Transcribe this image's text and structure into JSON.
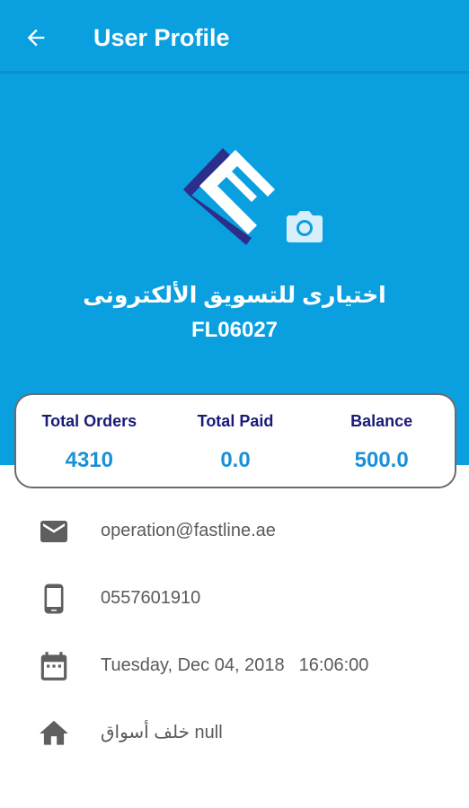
{
  "appbar": {
    "title": "User Profile",
    "back_icon": "arrow-back-icon",
    "color": "#0aa0e0"
  },
  "profile": {
    "logo_icon": "company-logo-f-icon",
    "camera_icon": "camera-icon",
    "company_name": "اختيارى للتسويق الألكترونى",
    "account_id": "FL06027"
  },
  "stats": [
    {
      "label": "Total Orders",
      "value": "4310"
    },
    {
      "label": "Total Paid",
      "value": "0.0"
    },
    {
      "label": "Balance",
      "value": "500.0"
    }
  ],
  "info": {
    "email": {
      "icon": "email-icon",
      "text": "operation@fastline.ae"
    },
    "phone": {
      "icon": "phone-icon",
      "text": "0557601910"
    },
    "date": {
      "icon": "calendar-icon",
      "date_text": "Tuesday, Dec 04, 2018",
      "time_text": "16:06:00"
    },
    "address": {
      "icon": "home-icon",
      "text": "خلف أسواق null"
    }
  },
  "colors": {
    "primary": "#0aa0e0",
    "stat_label": "#1a1a7a",
    "stat_value": "#1a90d8",
    "logo_dark": "#2b2f8a",
    "icon_gray": "#5f5f5f"
  }
}
